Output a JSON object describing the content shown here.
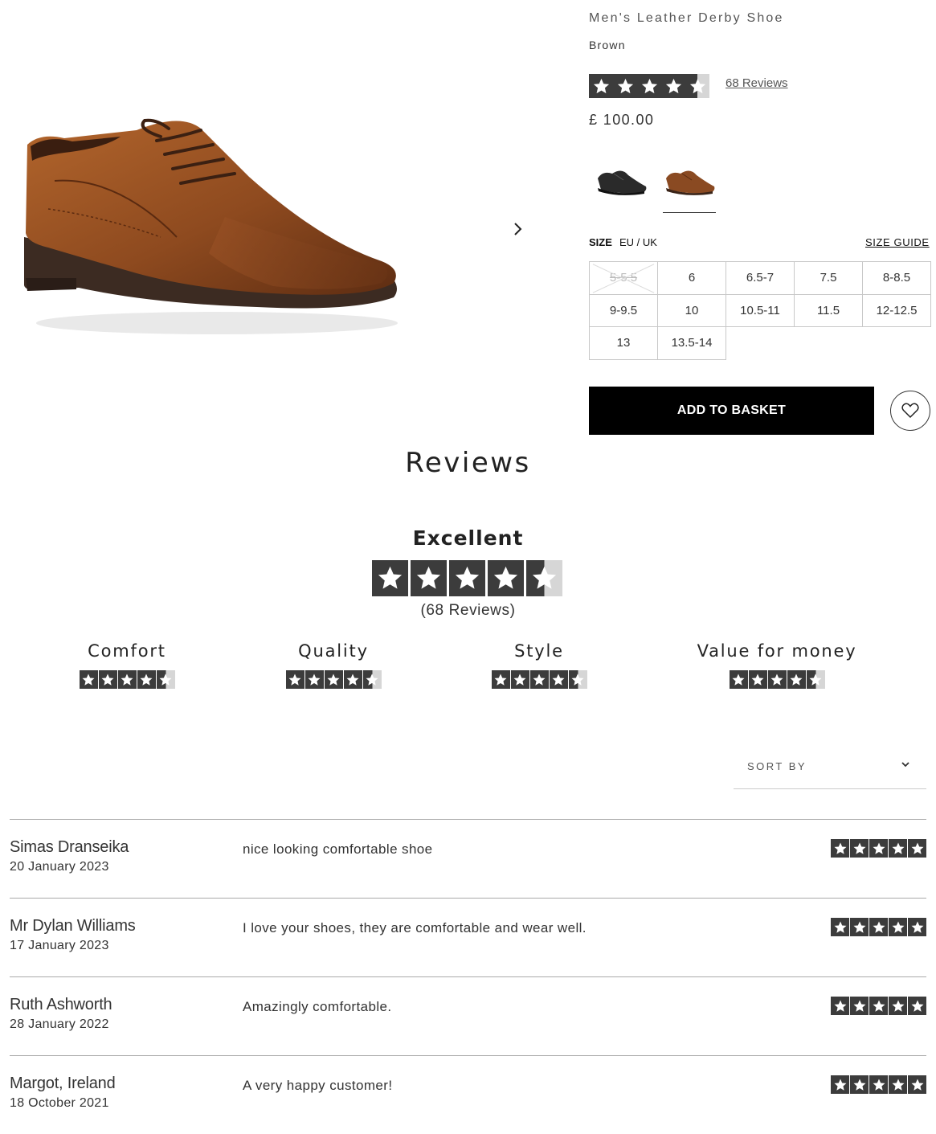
{
  "product": {
    "name": "Men's Leather Derby Shoe",
    "colour": "Brown",
    "rating": 4.5,
    "reviews_link": "68 Reviews",
    "price": "£ 100.00",
    "swatches": [
      "black",
      "brown"
    ],
    "selected_swatch": "brown"
  },
  "size": {
    "label": "SIZE",
    "system": "EU / UK",
    "guide": "SIZE GUIDE",
    "options": [
      {
        "label": "5-5.5",
        "available": false
      },
      {
        "label": "6",
        "available": true
      },
      {
        "label": "6.5-7",
        "available": true
      },
      {
        "label": "7.5",
        "available": true
      },
      {
        "label": "8-8.5",
        "available": true
      },
      {
        "label": "9-9.5",
        "available": true
      },
      {
        "label": "10",
        "available": true
      },
      {
        "label": "10.5-11",
        "available": true
      },
      {
        "label": "11.5",
        "available": true
      },
      {
        "label": "12-12.5",
        "available": true
      },
      {
        "label": "13",
        "available": true
      },
      {
        "label": "13.5-14",
        "available": true
      }
    ]
  },
  "actions": {
    "add_to_basket": "ADD TO BASKET"
  },
  "reviews_summary": {
    "heading": "Reviews",
    "rating_word": "Excellent",
    "overall_rating": 4.5,
    "count_text": "(68 Reviews)",
    "criteria": [
      {
        "label": "Comfort",
        "rating": 4.5
      },
      {
        "label": "Quality",
        "rating": 4.5
      },
      {
        "label": "Style",
        "rating": 4.5
      },
      {
        "label": "Value for money",
        "rating": 4.5
      }
    ]
  },
  "sort": {
    "label": "SORT BY"
  },
  "reviews": [
    {
      "author": "Simas Dranseika",
      "date": "20 January 2023",
      "text": "nice looking comfortable shoe",
      "rating": 5
    },
    {
      "author": "Mr Dylan Williams",
      "date": "17 January 2023",
      "text": "I love your shoes, they are comfortable and wear well.",
      "rating": 5
    },
    {
      "author": "Ruth Ashworth",
      "date": "28 January 2022",
      "text": "Amazingly comfortable.",
      "rating": 5
    },
    {
      "author": "Margot, Ireland",
      "date": "18 October 2021",
      "text": "A very happy customer!",
      "rating": 5
    }
  ],
  "colors": {
    "star_fill": "#3c3c3c",
    "star_empty": "#d6d6d6",
    "button_bg": "#000000",
    "leather_brown": "#8a4a22"
  },
  "icons": {
    "next": "chevron-right-icon",
    "wishlist": "heart-icon",
    "sort": "chevron-down-icon",
    "star": "star-icon"
  }
}
